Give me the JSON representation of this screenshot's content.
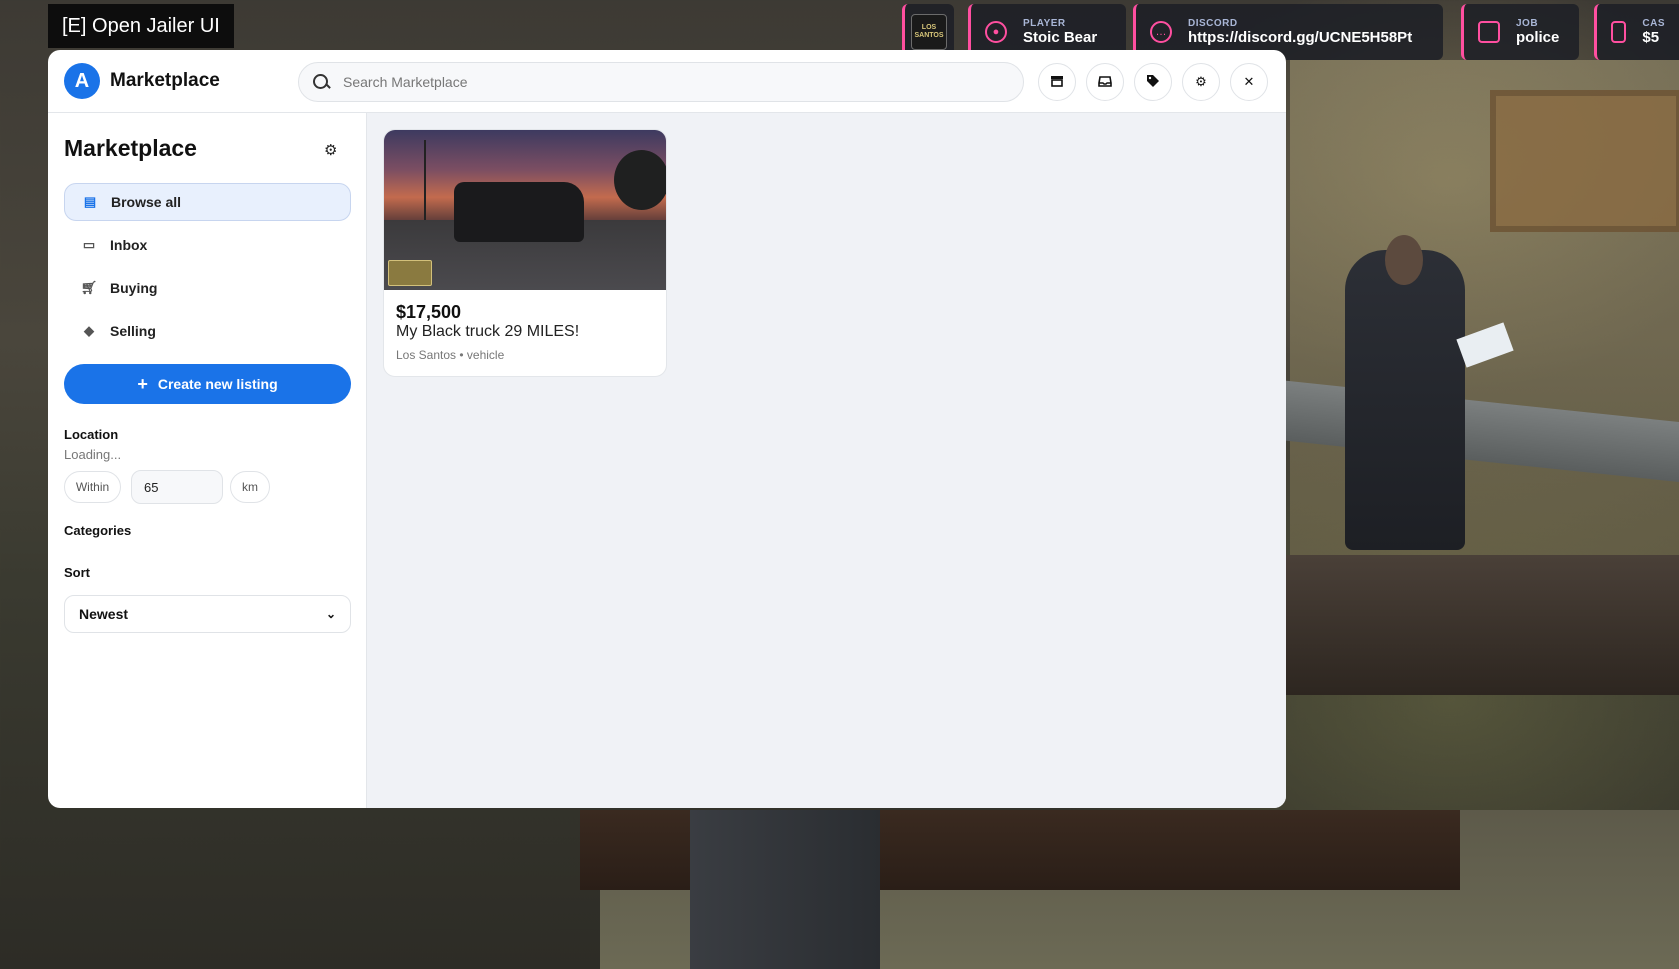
{
  "overlay": {
    "label": "[E] Open Jailer UI"
  },
  "hud": {
    "logo_text": "LOS SANTOS",
    "player": {
      "caption": "PLAYER",
      "value": "Stoic Bear"
    },
    "discord": {
      "caption": "DISCORD",
      "value": "https://discord.gg/UCNE5H58Pt"
    },
    "job": {
      "caption": "JOB",
      "value": "police"
    },
    "cash": {
      "caption": "CAS",
      "value": "$5"
    },
    "accent_color": "#ff4fa0"
  },
  "header": {
    "badge": "A",
    "title": "Marketplace",
    "search_placeholder": "Search Marketplace",
    "icons": [
      "store-icon",
      "inbox-icon",
      "tag-icon",
      "gear-icon",
      "close-icon"
    ]
  },
  "sidebar": {
    "title": "Marketplace",
    "nav": [
      {
        "label": "Browse all",
        "icon": "store-icon",
        "active": true
      },
      {
        "label": "Inbox",
        "icon": "inbox-icon",
        "active": false
      },
      {
        "label": "Buying",
        "icon": "cart-icon",
        "active": false
      },
      {
        "label": "Selling",
        "icon": "tags-icon",
        "active": false
      }
    ],
    "create_label": "Create new listing",
    "location_label": "Location",
    "location_status": "Loading...",
    "within_label": "Within",
    "radius_value": "65",
    "unit_label": "km",
    "categories_label": "Categories",
    "sort_label": "Sort",
    "sort_value": "Newest",
    "footer_text": "—"
  },
  "listings": [
    {
      "price": "$17,500",
      "title": "My Black truck 29 MILES!",
      "meta": "Los Santos • vehicle"
    }
  ],
  "colors": {
    "accent": "#1a73e8",
    "active_bg": "#e8f0fd"
  }
}
